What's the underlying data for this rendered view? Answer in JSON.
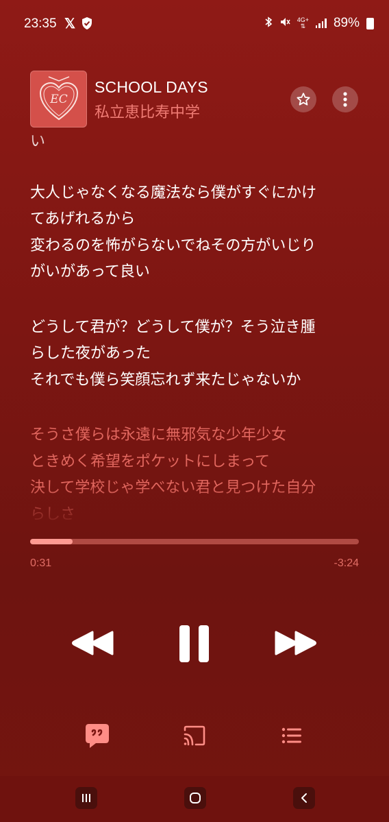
{
  "status_bar": {
    "time": "23:35",
    "network": "4G+",
    "battery": "89%"
  },
  "song": {
    "title": "SCHOOL DAYS",
    "artist": "私立恵比寿中学"
  },
  "lyrics": {
    "blocks": [
      {
        "lines": [
          "い"
        ],
        "state": "past"
      },
      {
        "lines": [
          "大人じゃなくなる魔法なら僕がすぐにかけ",
          "てあげれるから",
          "変わるのを怖がらないでねその方がいじり",
          "がいがあって良い"
        ],
        "state": "current"
      },
      {
        "lines": [
          "どうして君が？どうして僕が？そう泣き腫",
          "らした夜があった",
          "それでも僕ら笑顔忘れず来たじゃないか"
        ],
        "state": "current"
      },
      {
        "lines": [
          "そうさ僕らは永遠に無邪気な少年少女",
          "ときめく希望をポケットにしまって",
          "決して学校じゃ学べない君と見つけた自分",
          "らしさ"
        ],
        "state": "upcoming"
      }
    ]
  },
  "playback": {
    "elapsed": "0:31",
    "remaining": "-3:24",
    "progress_fraction": 0.13
  },
  "colors": {
    "background": "#7d1612",
    "accent": "#ef7b74",
    "progress_fill": "#ff9a92",
    "upcoming_lyrics": "#e2675f"
  },
  "icons": {
    "favorite": "star-icon",
    "more": "more-vertical-icon",
    "rewind": "rewind-icon",
    "pause": "pause-icon",
    "forward": "fast-forward-icon",
    "lyrics": "lyrics-icon",
    "cast": "cast-icon",
    "queue": "queue-icon"
  }
}
